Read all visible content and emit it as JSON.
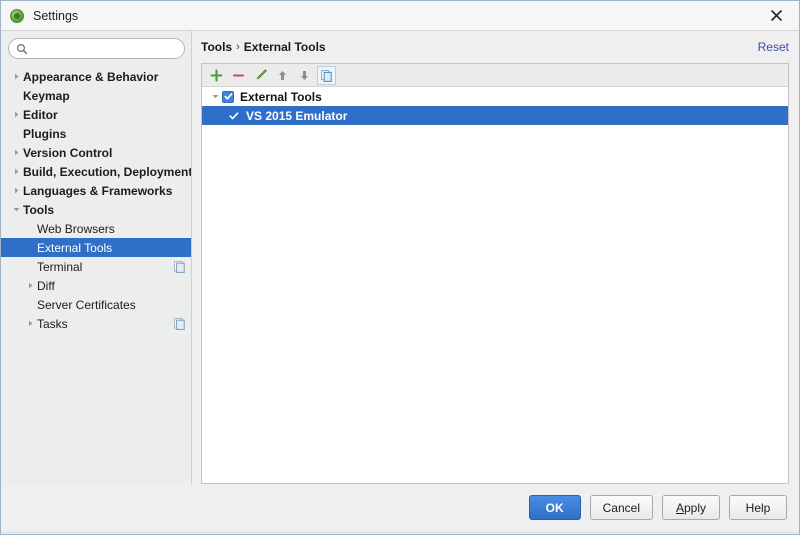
{
  "window": {
    "title": "Settings",
    "app_icon": "ide-logo-icon",
    "close_icon": "close-icon"
  },
  "search": {
    "icon": "search-icon",
    "value": "",
    "placeholder": ""
  },
  "sidebar": {
    "items": [
      {
        "label": "Appearance & Behavior",
        "level": "top",
        "arrow": "collapsed",
        "badge": false,
        "selected": false
      },
      {
        "label": "Keymap",
        "level": "top",
        "arrow": "none",
        "badge": false,
        "selected": false
      },
      {
        "label": "Editor",
        "level": "top",
        "arrow": "collapsed",
        "badge": false,
        "selected": false
      },
      {
        "label": "Plugins",
        "level": "top",
        "arrow": "none",
        "badge": false,
        "selected": false
      },
      {
        "label": "Version Control",
        "level": "top",
        "arrow": "collapsed",
        "badge": false,
        "selected": false
      },
      {
        "label": "Build, Execution, Deployment",
        "level": "top",
        "arrow": "collapsed",
        "badge": false,
        "selected": false
      },
      {
        "label": "Languages & Frameworks",
        "level": "top",
        "arrow": "collapsed",
        "badge": false,
        "selected": false
      },
      {
        "label": "Tools",
        "level": "top",
        "arrow": "expanded",
        "badge": false,
        "selected": false
      },
      {
        "label": "Web Browsers",
        "level": "child",
        "arrow": "none",
        "badge": false,
        "selected": false
      },
      {
        "label": "External Tools",
        "level": "child",
        "arrow": "none",
        "badge": false,
        "selected": true
      },
      {
        "label": "Terminal",
        "level": "child",
        "arrow": "none",
        "badge": true,
        "selected": false
      },
      {
        "label": "Diff",
        "level": "child",
        "arrow": "collapsed",
        "badge": false,
        "selected": false
      },
      {
        "label": "Server Certificates",
        "level": "child",
        "arrow": "none",
        "badge": false,
        "selected": false
      },
      {
        "label": "Tasks",
        "level": "child",
        "arrow": "collapsed",
        "badge": true,
        "selected": false
      }
    ]
  },
  "content": {
    "breadcrumb": {
      "parent": "Tools",
      "separator": "›",
      "current": "External Tools"
    },
    "reset_label": "Reset",
    "toolbar": [
      {
        "name": "add-button",
        "icon": "plus-icon",
        "title": "Add"
      },
      {
        "name": "remove-button",
        "icon": "minus-icon",
        "title": "Remove"
      },
      {
        "name": "edit-button",
        "icon": "pencil-icon",
        "title": "Edit"
      },
      {
        "name": "move-up-button",
        "icon": "arrow-up-icon",
        "title": "Move Up"
      },
      {
        "name": "move-down-button",
        "icon": "arrow-down-icon",
        "title": "Move Down"
      },
      {
        "name": "copy-button",
        "icon": "copy-icon",
        "title": "Copy"
      }
    ],
    "tree": {
      "group": {
        "label": "External Tools",
        "checked": true,
        "expanded": true
      },
      "items": [
        {
          "label": "VS 2015 Emulator",
          "checked": true,
          "selected": true
        }
      ]
    }
  },
  "footer": {
    "buttons": [
      {
        "name": "ok-button",
        "label": "OK",
        "primary": true,
        "mnemonic": ""
      },
      {
        "name": "cancel-button",
        "label": "Cancel",
        "primary": false,
        "mnemonic": ""
      },
      {
        "name": "apply-button",
        "label": "Apply",
        "primary": false,
        "mnemonic": "A"
      },
      {
        "name": "help-button",
        "label": "Help",
        "primary": false,
        "mnemonic": ""
      }
    ]
  },
  "colors": {
    "selection_blue": "#2f6fc7",
    "link_blue": "#3b4ea8",
    "window_bg": "#efefef",
    "sidebar_bg": "#eceded"
  }
}
